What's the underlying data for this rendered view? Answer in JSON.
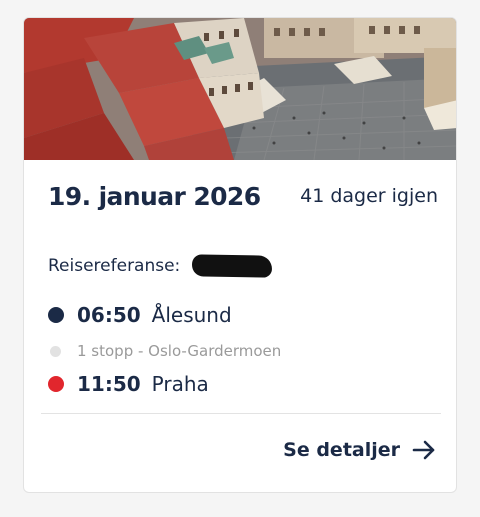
{
  "trip": {
    "date": "19. januar 2026",
    "days_left": "41 dager igjen",
    "reference_label": "Reisereferanse:",
    "departure": {
      "time": "06:50",
      "place": "Ålesund"
    },
    "stopover": "1 stopp - Oslo-Gardermoen",
    "arrival": {
      "time": "11:50",
      "place": "Praha"
    },
    "details_label": "Se detaljer"
  },
  "icons": {
    "departure_dot": "dot-navy-icon",
    "stopover_dot": "dot-gray-icon",
    "arrival_dot": "dot-red-icon",
    "details_arrow": "arrow-right-icon"
  },
  "colors": {
    "text_primary": "#1b2a46",
    "departure_dot": "#1b2a46",
    "stopover_dot": "#e2e2e2",
    "arrival_dot": "#e1262d",
    "muted_text": "#9a9a9a"
  }
}
